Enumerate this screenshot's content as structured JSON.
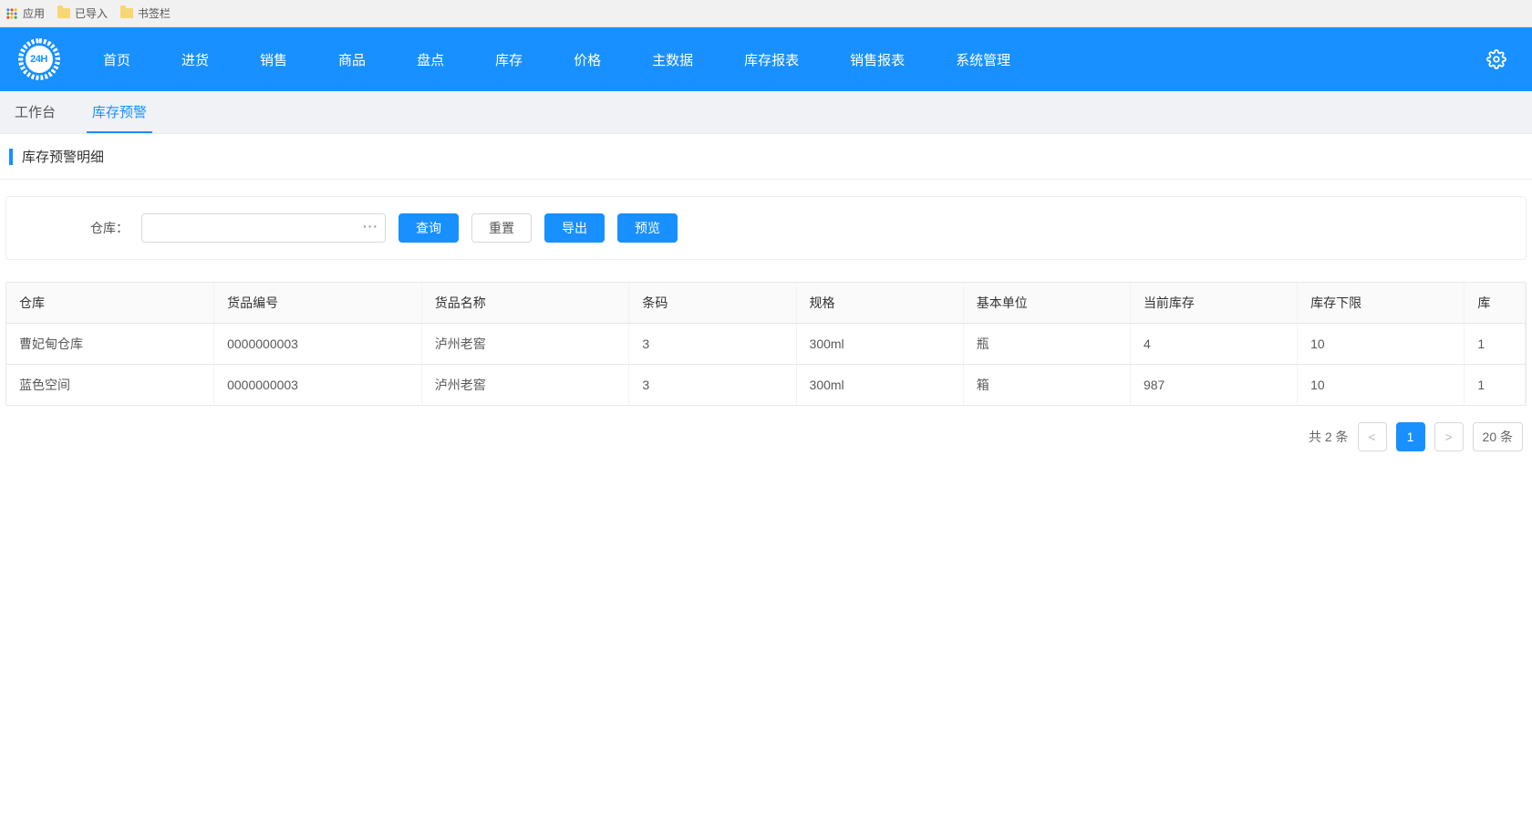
{
  "bookmarks": {
    "apps": "应用",
    "items": [
      "已导入",
      "书签栏"
    ]
  },
  "logo": {
    "text": "24H"
  },
  "nav": {
    "items": [
      "首页",
      "进货",
      "销售",
      "商品",
      "盘点",
      "库存",
      "价格",
      "主数据",
      "库存报表",
      "销售报表",
      "系统管理"
    ]
  },
  "tabs": {
    "items": [
      {
        "label": "工作台",
        "active": false
      },
      {
        "label": "库存预警",
        "active": true
      }
    ]
  },
  "section": {
    "title": "库存预警明细"
  },
  "filter": {
    "warehouse_label": "仓库：",
    "warehouse_value": "",
    "ellipsis": "···",
    "buttons": {
      "query": "查询",
      "reset": "重置",
      "export": "导出",
      "preview": "预览"
    }
  },
  "table": {
    "headers": [
      "仓库",
      "货品编号",
      "货品名称",
      "条码",
      "规格",
      "基本单位",
      "当前库存",
      "库存下限",
      "库"
    ],
    "rows": [
      {
        "cells": [
          "曹妃甸仓库",
          "0000000003",
          "泸州老窖",
          "3",
          "300ml",
          "瓶",
          "4",
          "10",
          "1"
        ]
      },
      {
        "cells": [
          "蓝色空间",
          "0000000003",
          "泸州老窖",
          "3",
          "300ml",
          "箱",
          "987",
          "10",
          "1"
        ]
      }
    ]
  },
  "pagination": {
    "total_text": "共 2 条",
    "prev": "<",
    "current": "1",
    "next": ">",
    "page_size": "20 条"
  }
}
